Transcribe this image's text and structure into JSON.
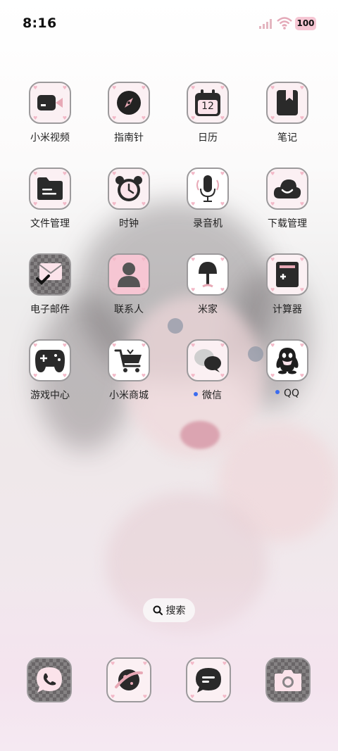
{
  "status_bar": {
    "time": "8:16",
    "battery": "100"
  },
  "apps": [
    {
      "label": "小米视频",
      "icon": "video-camera-icon",
      "dot": false,
      "date": ""
    },
    {
      "label": "指南针",
      "icon": "compass-icon",
      "dot": false,
      "date": ""
    },
    {
      "label": "日历",
      "icon": "calendar-icon",
      "dot": false,
      "date": "12"
    },
    {
      "label": "笔记",
      "icon": "notebook-icon",
      "dot": false,
      "date": ""
    },
    {
      "label": "文件管理",
      "icon": "folder-icon",
      "dot": false,
      "date": ""
    },
    {
      "label": "时钟",
      "icon": "alarm-clock-icon",
      "dot": false,
      "date": ""
    },
    {
      "label": "录音机",
      "icon": "microphone-icon",
      "dot": false,
      "date": ""
    },
    {
      "label": "下载管理",
      "icon": "cloud-download-icon",
      "dot": false,
      "date": ""
    },
    {
      "label": "电子邮件",
      "icon": "mail-icon",
      "dot": false,
      "date": ""
    },
    {
      "label": "联系人",
      "icon": "contact-person-icon",
      "dot": false,
      "date": ""
    },
    {
      "label": "米家",
      "icon": "smart-lamp-icon",
      "dot": false,
      "date": ""
    },
    {
      "label": "计算器",
      "icon": "calculator-icon",
      "dot": false,
      "date": ""
    },
    {
      "label": "游戏中心",
      "icon": "gamepad-icon",
      "dot": false,
      "date": ""
    },
    {
      "label": "小米商城",
      "icon": "shopping-cart-icon",
      "dot": false,
      "date": ""
    },
    {
      "label": "微信",
      "icon": "wechat-icon",
      "dot": true,
      "date": ""
    },
    {
      "label": "QQ",
      "icon": "qq-penguin-icon",
      "dot": true,
      "date": ""
    }
  ],
  "search": {
    "label": "搜索"
  },
  "dock": [
    {
      "icon": "phone-icon"
    },
    {
      "icon": "browser-planet-icon"
    },
    {
      "icon": "messages-icon"
    },
    {
      "icon": "camera-icon"
    }
  ],
  "colors": {
    "accent_pink": "#f6c6d3",
    "notification_dot": "#3b6cf0",
    "icon_border": "#9c9a9c"
  }
}
